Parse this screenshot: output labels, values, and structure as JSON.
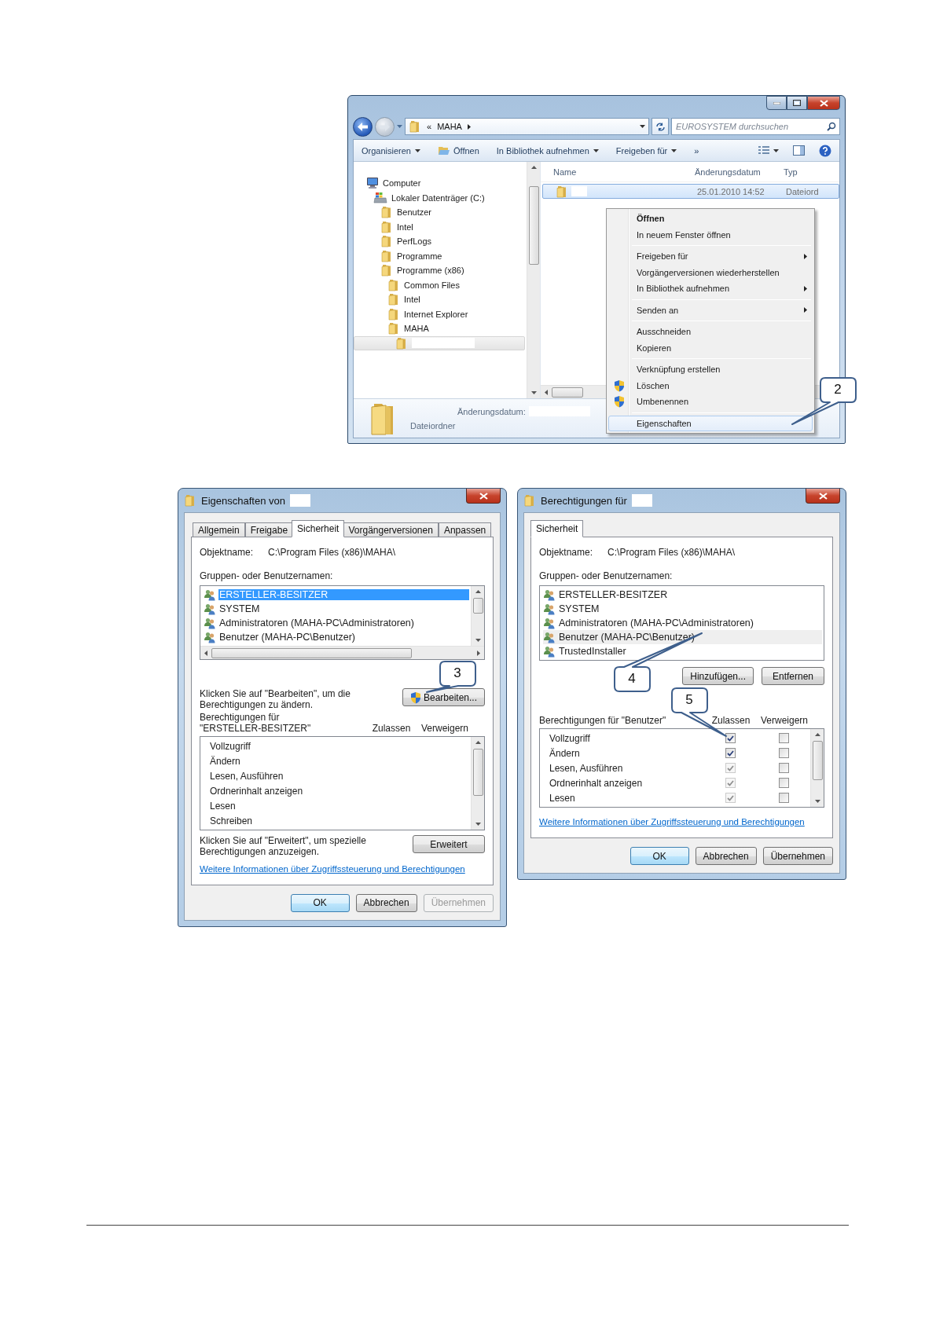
{
  "explorer": {
    "address": [
      "«",
      "MAHA"
    ],
    "search": {
      "placeholder": "EUROSYSTEM durchsuchen"
    },
    "toolbar": [
      {
        "label": "Organisieren",
        "kind": "menu"
      },
      {
        "label": "Öffnen",
        "kind": "open"
      },
      {
        "label": "In Bibliothek aufnehmen",
        "kind": "menu"
      },
      {
        "label": "Freigeben für",
        "kind": "menu"
      },
      {
        "label": "»",
        "kind": "more"
      }
    ],
    "tree": [
      {
        "label": "Computer",
        "kind": "computer",
        "selected": false,
        "children": [
          {
            "label": "Lokaler Datenträger (C:)",
            "kind": "drive",
            "selected": false,
            "children": [
              {
                "label": "Benutzer",
                "kind": "folder",
                "selected": false
              },
              {
                "label": "Intel",
                "kind": "folder",
                "selected": false
              },
              {
                "label": "PerfLogs",
                "kind": "folder",
                "selected": false
              },
              {
                "label": "Programme",
                "kind": "folder",
                "selected": false
              },
              {
                "label": "Programme (x86)",
                "kind": "folder",
                "selected": false,
                "children": [
                  {
                    "label": "Common Files",
                    "kind": "folder",
                    "selected": false
                  },
                  {
                    "label": "Intel",
                    "kind": "folder",
                    "selected": false
                  },
                  {
                    "label": "Internet Explorer",
                    "kind": "folder",
                    "selected": false
                  },
                  {
                    "label": "MAHA",
                    "kind": "folder",
                    "selected": false,
                    "children": [
                      {
                        "kind": "folder",
                        "selected": true
                      }
                    ]
                  }
                ]
              }
            ]
          }
        ]
      }
    ],
    "columns": [
      "Name",
      "Änderungsdatum",
      "Typ"
    ],
    "rows": [
      {
        "date": "25.01.2010 14:52",
        "type": "Dateiord",
        "selected": true
      }
    ],
    "details": {
      "label": "Änderungsdatum:",
      "type": "Dateiordner"
    },
    "context_menu": [
      [
        {
          "label": "Öffnen",
          "kind": "default",
          "selected": false
        },
        {
          "label": "In neuem Fenster öffnen",
          "kind": "plain",
          "selected": false
        }
      ],
      [
        {
          "label": "Freigeben für",
          "kind": "submenu",
          "selected": false
        },
        {
          "label": "Vorgängerversionen wiederherstellen",
          "kind": "plain",
          "selected": false
        },
        {
          "label": "In Bibliothek aufnehmen",
          "kind": "submenu",
          "selected": false
        }
      ],
      [
        {
          "label": "Senden an",
          "kind": "submenu",
          "selected": false
        }
      ],
      [
        {
          "label": "Ausschneiden",
          "kind": "plain",
          "selected": false
        },
        {
          "label": "Kopieren",
          "kind": "plain",
          "selected": false
        }
      ],
      [
        {
          "label": "Verknüpfung erstellen",
          "kind": "plain",
          "selected": false
        },
        {
          "label": "Löschen",
          "kind": "shield",
          "selected": false
        },
        {
          "label": "Umbenennen",
          "kind": "shield",
          "selected": false
        }
      ],
      [
        {
          "label": "Eigenschaften",
          "kind": "plain",
          "selected": true
        }
      ]
    ],
    "callout": "2"
  },
  "properties_dialog": {
    "title": "Eigenschaften von",
    "tabs": [
      {
        "label": "Allgemein",
        "selected": false
      },
      {
        "label": "Freigabe",
        "selected": false
      },
      {
        "label": "Sicherheit",
        "selected": true
      },
      {
        "label": "Vorgängerversionen",
        "selected": false
      },
      {
        "label": "Anpassen",
        "selected": false
      }
    ],
    "object_label": "Objektname:",
    "object_path": "C:\\Program Files (x86)\\MAHA\\",
    "groups_label": "Gruppen- oder Benutzernamen:",
    "users": [
      {
        "name": "ERSTELLER-BESITZER",
        "selected": true
      },
      {
        "name": "SYSTEM",
        "selected": false
      },
      {
        "name": "Administratoren (MAHA-PC\\Administratoren)",
        "selected": false
      },
      {
        "name": "Benutzer (MAHA-PC\\Benutzer)",
        "selected": false
      }
    ],
    "edit_hint": "Klicken Sie auf \"Bearbeiten\", um die Berechtigungen zu ändern.",
    "edit_button": "Bearbeiten...",
    "permissions_label": [
      "Berechtigungen für",
      "\"ERSTELLER-BESITZER\""
    ],
    "allow_header": "Zulassen",
    "deny_header": "Verweigern",
    "permissions": [
      "Vollzugriff",
      "Ändern",
      "Lesen, Ausführen",
      "Ordnerinhalt anzeigen",
      "Lesen",
      "Schreiben"
    ],
    "advanced_hint": "Klicken Sie auf \"Erweitert\", um spezielle Berechtigungen anzuzeigen.",
    "advanced_button": "Erweitert",
    "link": "Weitere Informationen über Zugriffssteuerung und Berechtigungen",
    "buttons": [
      {
        "label": "OK",
        "default": true,
        "disabled": false
      },
      {
        "label": "Abbrechen",
        "default": false,
        "disabled": false
      },
      {
        "label": "Übernehmen",
        "default": false,
        "disabled": true
      }
    ],
    "callout": "3"
  },
  "permissions_dialog": {
    "title": "Berechtigungen für",
    "tabs": [
      {
        "label": "Sicherheit",
        "selected": true
      }
    ],
    "object_label": "Objektname:",
    "object_path": "C:\\Program Files (x86)\\MAHA\\",
    "groups_label": "Gruppen- oder Benutzernamen:",
    "users": [
      {
        "name": "ERSTELLER-BESITZER",
        "selected": false
      },
      {
        "name": "SYSTEM",
        "selected": false
      },
      {
        "name": "Administratoren (MAHA-PC\\Administratoren)",
        "selected": false
      },
      {
        "name": "Benutzer (MAHA-PC\\Benutzer)",
        "selected": true
      },
      {
        "name": "TrustedInstaller",
        "selected": false
      }
    ],
    "list_buttons": [
      "Hinzufügen...",
      "Entfernen"
    ],
    "permissions_label": [
      "Berechtigungen für \"Benutzer\""
    ],
    "allow_header": "Zulassen",
    "deny_header": "Verweigern",
    "permissions": [
      {
        "label": "Vollzugriff",
        "allow": {
          "checked": true,
          "disabled": false
        },
        "deny": {
          "checked": false,
          "disabled": false
        }
      },
      {
        "label": "Ändern",
        "allow": {
          "checked": true,
          "disabled": false
        },
        "deny": {
          "checked": false,
          "disabled": false
        }
      },
      {
        "label": "Lesen, Ausführen",
        "allow": {
          "checked": true,
          "disabled": true
        },
        "deny": {
          "checked": false,
          "disabled": false
        }
      },
      {
        "label": "Ordnerinhalt anzeigen",
        "allow": {
          "checked": true,
          "disabled": true
        },
        "deny": {
          "checked": false,
          "disabled": false
        }
      },
      {
        "label": "Lesen",
        "allow": {
          "checked": true,
          "disabled": true
        },
        "deny": {
          "checked": false,
          "disabled": false
        }
      }
    ],
    "link": "Weitere Informationen über Zugriffssteuerung und Berechtigungen",
    "buttons": [
      {
        "label": "OK",
        "default": true,
        "disabled": false
      },
      {
        "label": "Abbrechen",
        "default": false,
        "disabled": false
      },
      {
        "label": "Übernehmen",
        "default": false,
        "disabled": false
      }
    ],
    "callouts": [
      "4",
      "5"
    ]
  }
}
